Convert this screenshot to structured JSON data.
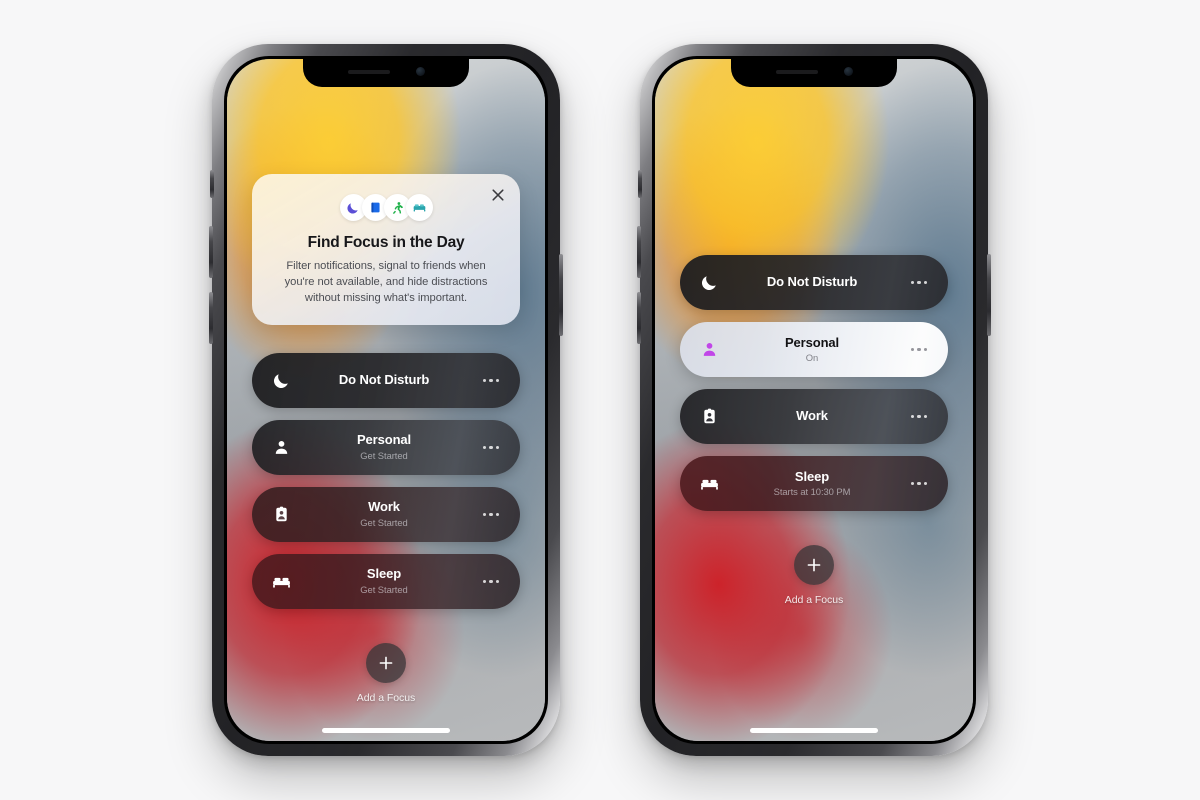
{
  "page": {
    "background_color": "#f7f7f8",
    "device_count": 2
  },
  "icons": {
    "moon": "crescent-moon-icon",
    "book": "book-icon",
    "running": "running-person-icon",
    "bed": "bed-icon",
    "person": "person-icon",
    "badge": "id-badge-icon",
    "close": "close-icon",
    "plus": "plus-icon",
    "more": "more-options-icon"
  },
  "colors": {
    "icon_moon": "#5b4fd6",
    "icon_book": "#1a6ae8",
    "icon_running": "#1fb14a",
    "icon_bed_teal": "#2aa5ad",
    "active_person_purple": "#c146e8",
    "card_dark": "#1f1f22",
    "active_card_bg": "#f2f4f8",
    "close_glyph": "#3a3a3e",
    "home_indicator": "#ffffff"
  },
  "phone_left": {
    "name": "iphone-onboarding-state",
    "promo": {
      "title": "Find Focus in the Day",
      "body": "Filter notifications, signal to friends when you're not available, and hide distractions without missing what's important.",
      "close_label": "✕",
      "icons": [
        "crescent-moon-icon",
        "book-icon",
        "running-person-icon",
        "bed-icon"
      ]
    },
    "focus_cards": [
      {
        "id": "do-not-disturb",
        "title": "Do Not Disturb",
        "subtitle": "",
        "icon": "crescent-moon-icon",
        "active": false,
        "style": "dark-neutral"
      },
      {
        "id": "personal",
        "title": "Personal",
        "subtitle": "Get Started",
        "icon": "person-icon",
        "active": false,
        "style": "dark-mid"
      },
      {
        "id": "work",
        "title": "Work",
        "subtitle": "Get Started",
        "icon": "id-badge-icon",
        "active": false,
        "style": "dark-warm"
      },
      {
        "id": "sleep",
        "title": "Sleep",
        "subtitle": "Get Started",
        "icon": "bed-icon",
        "active": false,
        "style": "dark-red"
      }
    ],
    "add_focus": {
      "label": "Add a Focus",
      "glyph": "+"
    }
  },
  "phone_right": {
    "name": "iphone-configured-state",
    "focus_cards": [
      {
        "id": "do-not-disturb",
        "title": "Do Not Disturb",
        "subtitle": "",
        "icon": "crescent-moon-icon",
        "active": false,
        "style": "dark-neutral"
      },
      {
        "id": "personal",
        "title": "Personal",
        "subtitle": "On",
        "icon": "person-icon",
        "active": true,
        "style": "active"
      },
      {
        "id": "work",
        "title": "Work",
        "subtitle": "",
        "icon": "id-badge-icon",
        "active": false,
        "style": "dark-mid"
      },
      {
        "id": "sleep",
        "title": "Sleep",
        "subtitle": "Starts at 10:30 PM",
        "icon": "bed-icon",
        "active": false,
        "style": "dark-red"
      }
    ],
    "add_focus": {
      "label": "Add a Focus",
      "glyph": "+"
    }
  }
}
